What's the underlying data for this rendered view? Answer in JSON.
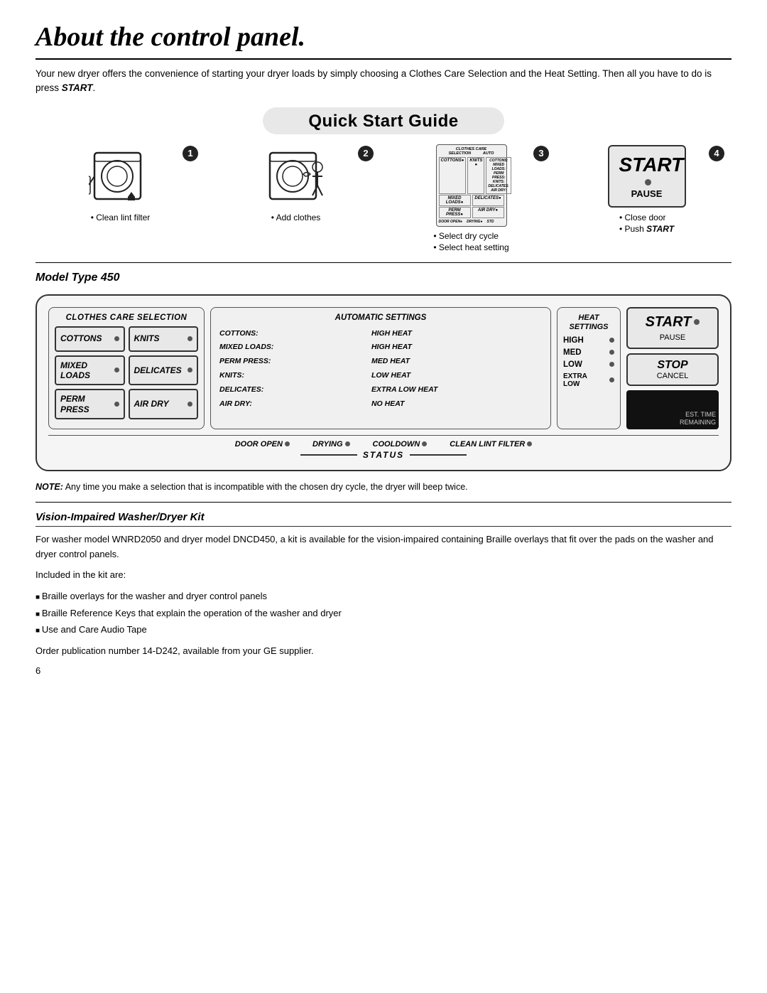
{
  "page": {
    "title": "About the control panel.",
    "intro": "Your new dryer offers the convenience of starting your dryer loads by simply choosing a Clothes Care Selection and the Heat Setting. Then all you have to do is press",
    "intro_bold": "START",
    "qsg_title": "Quick Start Guide",
    "model_type": "Model Type 450",
    "note_label": "NOTE:",
    "note_text": "Any time you make a selection that is incompatible with the chosen dry cycle, the dryer will beep twice.",
    "page_number": "6"
  },
  "steps": [
    {
      "num": "1",
      "bullets": [
        "Clean lint filter"
      ]
    },
    {
      "num": "2",
      "bullets": [
        "Add clothes"
      ]
    },
    {
      "num": "3",
      "bullets": [
        "Select dry cycle",
        "Select heat setting"
      ]
    },
    {
      "num": "4",
      "bullets": [
        "Close door",
        "Push START"
      ]
    }
  ],
  "control_panel": {
    "ccs_title": "CLOTHES CARE SELECTION",
    "ccs_buttons": [
      {
        "label": "COTTONS",
        "dot_side": "right"
      },
      {
        "label": "KNITS",
        "dot_side": "right"
      },
      {
        "label": "MIXED\nLOADS",
        "dot_side": "right"
      },
      {
        "label": "DELICATES",
        "dot_side": "right"
      },
      {
        "label": "PERM\nPRESS",
        "dot_side": "right"
      },
      {
        "label": "AIR DRY",
        "dot_side": "right"
      }
    ],
    "auto_title": "AUTOMATIC SETTINGS",
    "auto_rows": [
      {
        "label": "COTTONS:",
        "value": "HIGH HEAT"
      },
      {
        "label": "MIXED LOADS:",
        "value": "HIGH HEAT"
      },
      {
        "label": "PERM PRESS:",
        "value": "MED HEAT"
      },
      {
        "label": "KNITS:",
        "value": "LOW HEAT"
      },
      {
        "label": "DELICATES:",
        "value": "EXTRA LOW HEAT"
      },
      {
        "label": "AIR DRY:",
        "value": "NO HEAT"
      }
    ],
    "heat_title": "HEAT\nSETTINGS",
    "heat_buttons": [
      {
        "label": "HIGH"
      },
      {
        "label": "MED"
      },
      {
        "label": "LOW"
      },
      {
        "label": "EXTRA\nLOW"
      }
    ],
    "start_big": "START",
    "start_small": "PAUSE",
    "stop_big": "STOP",
    "stop_small": "CANCEL",
    "time_label": "EST. TIME\nREMAINING",
    "status_items": [
      {
        "label": "DOOR OPEN"
      },
      {
        "label": "DRYING"
      },
      {
        "label": "COOLDOWN"
      },
      {
        "label": "CLEAN LINT FILTER"
      }
    ],
    "status_bar_label": "STATUS"
  },
  "vision": {
    "title": "Vision-Impaired Washer/Dryer Kit",
    "para1": "For washer model WNRD2050 and dryer model DNCD450, a kit is available for the vision-impaired containing Braille overlays that fit over the pads on the washer and dryer control panels.",
    "para2": "Included in the kit are:",
    "list": [
      "Braille overlays for the washer and dryer control panels",
      "Braille Reference Keys that explain the operation of the washer and dryer",
      "Use and Care Audio Tape"
    ],
    "para3": "Order publication number 14-D242, available from your GE supplier."
  }
}
